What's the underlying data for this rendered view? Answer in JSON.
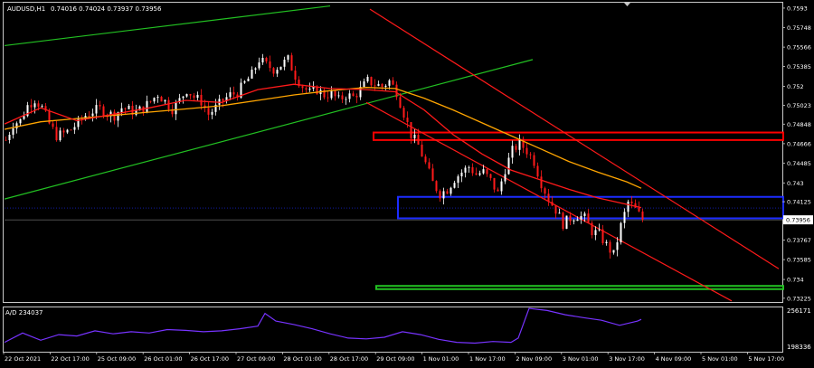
{
  "header": {
    "symbol": "AUDUSD,H1",
    "ohlc": "0.74016 0.74024 0.73937 0.73956"
  },
  "indicator": {
    "label": "A/D 234037",
    "scale_top": "256171",
    "scale_bottom": "198336"
  },
  "colors": {
    "background": "#000000",
    "frame": "#c8c8c8",
    "bull_candle": "#ffffff",
    "bear_candle": "#ff1a1a",
    "ma_fast": "#ff1a1a",
    "ma_slow": "#ffa500",
    "uptrend_channel": "#22c022",
    "downtrend_channel": "#ff1a1a",
    "zone_resistance": "#ff0000",
    "zone_pivot": "#1c2cff",
    "zone_support": "#22c022",
    "ad_line": "#7733ff"
  },
  "chart_data": {
    "type": "candlestick",
    "title": "AUDUSD,H1",
    "x_ticks": [
      "22 Oct 2021",
      "22 Oct 17:00",
      "25 Oct 09:00",
      "26 Oct 01:00",
      "26 Oct 17:00",
      "27 Oct 09:00",
      "28 Oct 01:00",
      "28 Oct 17:00",
      "29 Oct 09:00",
      "1 Nov 01:00",
      "1 Nov 17:00",
      "2 Nov 09:00",
      "3 Nov 01:00",
      "3 Nov 17:00",
      "4 Nov 09:00",
      "5 Nov 01:00",
      "5 Nov 17:00"
    ],
    "y_ticks": [
      0.7593,
      0.75748,
      0.75566,
      0.75385,
      0.752,
      0.75023,
      0.74848,
      0.74666,
      0.74485,
      0.743,
      0.74125,
      0.73956,
      0.73767,
      0.73585,
      0.734,
      0.73225
    ],
    "current_price_label": "0.73956",
    "ylim": [
      0.7319,
      0.7598
    ],
    "close_path": [
      [
        0,
        0.747
      ],
      [
        2,
        0.7485
      ],
      [
        4,
        0.7488
      ],
      [
        6,
        0.7502
      ],
      [
        8,
        0.7508
      ],
      [
        10,
        0.75
      ],
      [
        12,
        0.7485
      ],
      [
        14,
        0.7474
      ],
      [
        16,
        0.7476
      ],
      [
        18,
        0.748
      ],
      [
        20,
        0.7486
      ],
      [
        22,
        0.7493
      ],
      [
        24,
        0.7497
      ],
      [
        26,
        0.7499
      ],
      [
        28,
        0.7495
      ],
      [
        30,
        0.7493
      ],
      [
        32,
        0.75
      ],
      [
        34,
        0.7498
      ],
      [
        36,
        0.7496
      ],
      [
        38,
        0.75
      ],
      [
        40,
        0.7506
      ],
      [
        42,
        0.7513
      ],
      [
        44,
        0.7506
      ],
      [
        46,
        0.7499
      ],
      [
        48,
        0.7507
      ],
      [
        50,
        0.7517
      ],
      [
        52,
        0.751
      ],
      [
        54,
        0.7506
      ],
      [
        56,
        0.7494
      ],
      [
        58,
        0.75
      ],
      [
        60,
        0.7507
      ],
      [
        62,
        0.7512
      ],
      [
        64,
        0.7514
      ],
      [
        66,
        0.7523
      ],
      [
        68,
        0.7531
      ],
      [
        70,
        0.7545
      ],
      [
        72,
        0.754
      ],
      [
        74,
        0.7536
      ],
      [
        76,
        0.754
      ],
      [
        78,
        0.7545
      ],
      [
        80,
        0.753
      ],
      [
        82,
        0.752
      ],
      [
        84,
        0.7514
      ],
      [
        86,
        0.7517
      ],
      [
        88,
        0.7512
      ],
      [
        90,
        0.7513
      ],
      [
        92,
        0.7507
      ],
      [
        94,
        0.7512
      ],
      [
        96,
        0.751
      ],
      [
        98,
        0.7517
      ],
      [
        100,
        0.7525
      ],
      [
        102,
        0.7522
      ],
      [
        104,
        0.752
      ],
      [
        106,
        0.7525
      ],
      [
        108,
        0.7515
      ],
      [
        110,
        0.7495
      ],
      [
        112,
        0.7475
      ],
      [
        114,
        0.7465
      ],
      [
        116,
        0.7448
      ],
      [
        118,
        0.743
      ],
      [
        120,
        0.742
      ],
      [
        122,
        0.7424
      ],
      [
        124,
        0.7434
      ],
      [
        126,
        0.744
      ],
      [
        128,
        0.7445
      ],
      [
        130,
        0.7438
      ],
      [
        132,
        0.744
      ],
      [
        134,
        0.7432
      ],
      [
        136,
        0.742
      ],
      [
        138,
        0.7443
      ],
      [
        140,
        0.746
      ],
      [
        142,
        0.7467
      ],
      [
        144,
        0.746
      ],
      [
        146,
        0.745
      ],
      [
        148,
        0.743
      ],
      [
        150,
        0.7415
      ],
      [
        152,
        0.7405
      ],
      [
        154,
        0.7392
      ],
      [
        156,
        0.7397
      ],
      [
        158,
        0.74
      ],
      [
        160,
        0.7397
      ],
      [
        162,
        0.7385
      ],
      [
        164,
        0.7382
      ],
      [
        166,
        0.7372
      ],
      [
        168,
        0.7363
      ],
      [
        170,
        0.739
      ],
      [
        172,
        0.7412
      ],
      [
        174,
        0.7405
      ],
      [
        176,
        0.7396
      ]
    ],
    "ma_fast": [
      [
        0,
        0.7485
      ],
      [
        10,
        0.75
      ],
      [
        20,
        0.7488
      ],
      [
        30,
        0.7494
      ],
      [
        40,
        0.75
      ],
      [
        50,
        0.7507
      ],
      [
        60,
        0.7505
      ],
      [
        70,
        0.7517
      ],
      [
        80,
        0.7522
      ],
      [
        90,
        0.7518
      ],
      [
        100,
        0.7517
      ],
      [
        108,
        0.7515
      ],
      [
        116,
        0.7498
      ],
      [
        124,
        0.7475
      ],
      [
        132,
        0.7457
      ],
      [
        140,
        0.7442
      ],
      [
        148,
        0.7433
      ],
      [
        156,
        0.7424
      ],
      [
        164,
        0.7416
      ],
      [
        172,
        0.741
      ],
      [
        176,
        0.7407
      ]
    ],
    "ma_slow": [
      [
        0,
        0.748
      ],
      [
        10,
        0.7487
      ],
      [
        20,
        0.749
      ],
      [
        30,
        0.7493
      ],
      [
        40,
        0.7496
      ],
      [
        50,
        0.7499
      ],
      [
        60,
        0.7502
      ],
      [
        70,
        0.7507
      ],
      [
        80,
        0.7512
      ],
      [
        90,
        0.7516
      ],
      [
        100,
        0.7519
      ],
      [
        108,
        0.7518
      ],
      [
        116,
        0.7509
      ],
      [
        124,
        0.7498
      ],
      [
        132,
        0.7486
      ],
      [
        140,
        0.7474
      ],
      [
        148,
        0.7462
      ],
      [
        156,
        0.745
      ],
      [
        164,
        0.744
      ],
      [
        172,
        0.7431
      ],
      [
        176,
        0.7425
      ]
    ],
    "uptrend_channel": {
      "upper": [
        [
          0,
          0.7558
        ],
        [
          90,
          0.7595
        ]
      ],
      "lower": [
        [
          0,
          0.7415
        ],
        [
          146,
          0.7545
        ]
      ]
    },
    "downtrend_channel": {
      "upper": [
        [
          101,
          0.7592
        ],
        [
          214,
          0.735
        ]
      ],
      "lower": [
        [
          100,
          0.7505
        ],
        [
          201,
          0.732
        ]
      ]
    },
    "zones": [
      {
        "name": "resistance",
        "low": 0.747,
        "high": 0.7477
      },
      {
        "name": "pivot",
        "low": 0.7397,
        "high": 0.7417
      },
      {
        "name": "support",
        "low": 0.7331,
        "high": 0.7334
      }
    ],
    "ad_line": [
      [
        0,
        0.2
      ],
      [
        5,
        0.42
      ],
      [
        10,
        0.25
      ],
      [
        15,
        0.38
      ],
      [
        20,
        0.35
      ],
      [
        25,
        0.47
      ],
      [
        30,
        0.4
      ],
      [
        35,
        0.45
      ],
      [
        40,
        0.42
      ],
      [
        45,
        0.5
      ],
      [
        50,
        0.48
      ],
      [
        55,
        0.45
      ],
      [
        60,
        0.47
      ],
      [
        65,
        0.52
      ],
      [
        70,
        0.58
      ],
      [
        72,
        0.88
      ],
      [
        75,
        0.7
      ],
      [
        80,
        0.62
      ],
      [
        85,
        0.52
      ],
      [
        90,
        0.4
      ],
      [
        95,
        0.3
      ],
      [
        100,
        0.28
      ],
      [
        105,
        0.32
      ],
      [
        110,
        0.45
      ],
      [
        115,
        0.38
      ],
      [
        120,
        0.27
      ],
      [
        125,
        0.2
      ],
      [
        130,
        0.18
      ],
      [
        135,
        0.22
      ],
      [
        140,
        0.2
      ],
      [
        142,
        0.3
      ],
      [
        145,
        1.0
      ],
      [
        150,
        0.95
      ],
      [
        155,
        0.85
      ],
      [
        160,
        0.78
      ],
      [
        165,
        0.72
      ],
      [
        170,
        0.6
      ],
      [
        175,
        0.7
      ],
      [
        176,
        0.74
      ]
    ]
  }
}
